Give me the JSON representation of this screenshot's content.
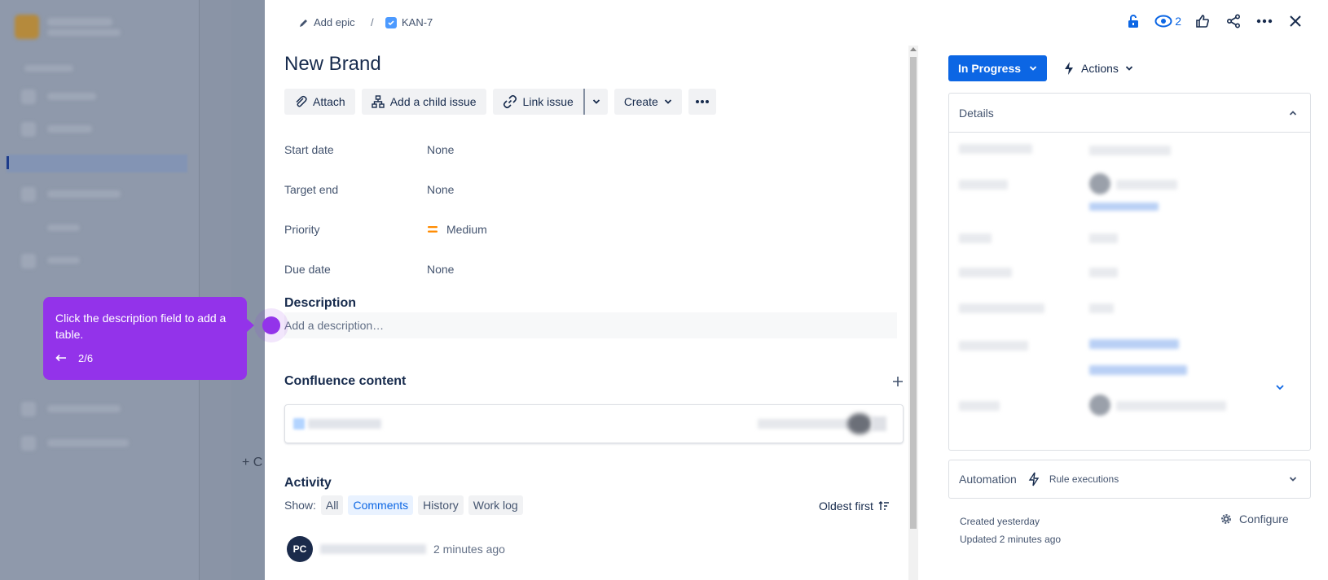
{
  "breadcrumb": {
    "epic_label": "Add epic",
    "separator": "/",
    "issue_key": "KAN-7"
  },
  "header": {
    "watch_count": "2"
  },
  "issue": {
    "title": "New Brand"
  },
  "toolbar": {
    "attach": "Attach",
    "add_child": "Add a child issue",
    "link_issue": "Link issue",
    "create": "Create"
  },
  "fields": [
    {
      "label": "Start date",
      "value": "None"
    },
    {
      "label": "Target end",
      "value": "None"
    },
    {
      "label": "Priority",
      "value": "Medium"
    },
    {
      "label": "Due date",
      "value": "None"
    }
  ],
  "description": {
    "heading": "Description",
    "placeholder": "Add a description…"
  },
  "confluence": {
    "heading": "Confluence content"
  },
  "activity": {
    "heading": "Activity",
    "show_label": "Show:",
    "filters": [
      "All",
      "Comments",
      "History",
      "Work log"
    ],
    "active_filter": "Comments",
    "sort": "Oldest first",
    "avatar_initials": "PC",
    "time": "2 minutes ago"
  },
  "sidebar": {
    "status": "In Progress",
    "actions": "Actions",
    "details_heading": "Details",
    "automation": "Automation",
    "rule_executions": "Rule executions",
    "created": "Created yesterday",
    "updated": "Updated 2 minutes ago",
    "configure": "Configure"
  },
  "tooltip": {
    "text": "Click the description field to add a table.",
    "progress": "2/6"
  },
  "background": {
    "add_label": "+ C"
  },
  "colors": {
    "accent": "#0c66e4",
    "guide": "#9333ea",
    "priority": "#ff8b00"
  }
}
